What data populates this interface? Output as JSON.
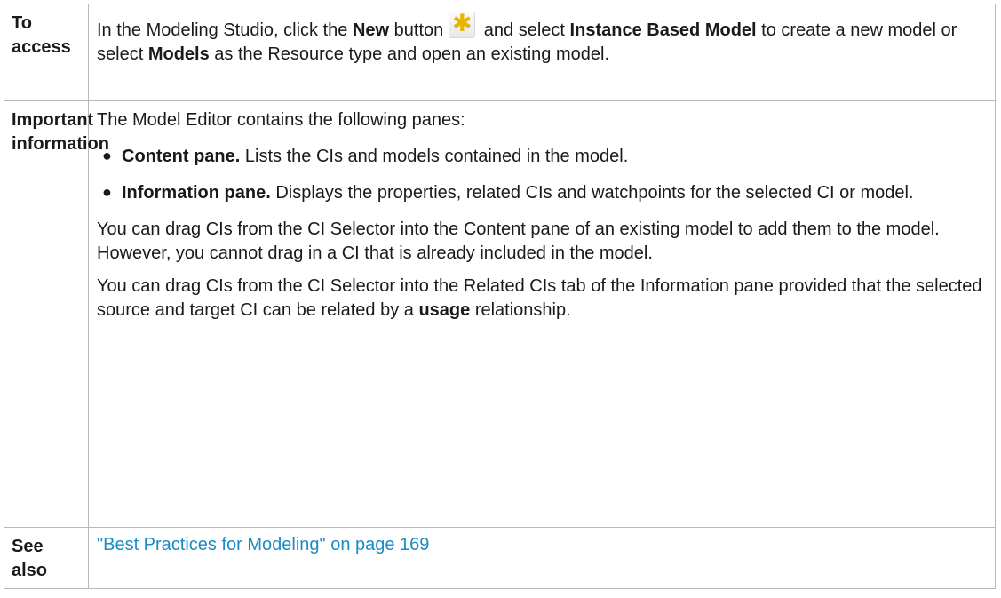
{
  "access": {
    "label": "To access",
    "t1": "In the Modeling Studio, click the ",
    "b1": "New",
    "t2": " button",
    "icon": "new-star-icon",
    "t3": " and select ",
    "b2": "Instance Based Model",
    "t4": " to create a new model or select ",
    "b3": "Models",
    "t5": " as the Resource type and open an existing model."
  },
  "important": {
    "label": "Important information",
    "intro": "The Model Editor contains the following panes:",
    "panes": [
      {
        "title": "Content pane.",
        "text": " Lists the CIs and models contained in the model."
      },
      {
        "title": "Information pane.",
        "text": " Displays the properties, related CIs and watchpoints for the selected CI or model."
      }
    ],
    "para1": "You can drag CIs from the CI Selector into the Content pane of an existing model to add them to the model. However, you cannot drag in a CI that is already included in the model.",
    "para2_t1": "You can drag CIs from the CI Selector into the Related CIs tab of the Information pane provided that the selected source and target CI can be related by a ",
    "para2_b": "usage",
    "para2_t2": " relationship."
  },
  "see_also": {
    "label": "See also",
    "link": "\"Best Practices for Modeling\" on page 169"
  },
  "colors": {
    "link": "#1a8cc4",
    "border": "#b8b8b8",
    "icon_star": "#e8b400"
  }
}
